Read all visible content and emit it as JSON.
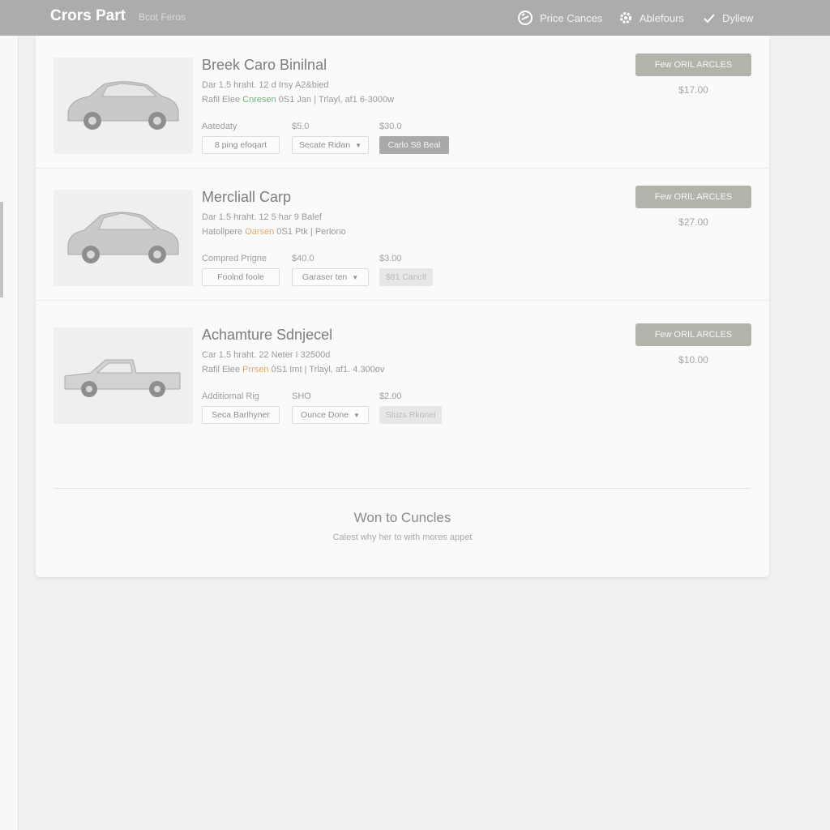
{
  "header": {
    "brand": "Crors Part",
    "brand_sub": "Bcot Feros",
    "nav": [
      {
        "label": "Price Cances",
        "icon": "refresh-icon"
      },
      {
        "label": "Ablefours",
        "icon": "gear-icon"
      },
      {
        "label": "Dyllew",
        "icon": "check-icon"
      }
    ]
  },
  "listings": [
    {
      "title": "Breek Caro Binilnal",
      "spec_line1": "Dar 1.5 hraht. 12 d Irsy A2&bied",
      "spec_line2_pre": "Rafil Elee",
      "spec_highlight": "Cnresen",
      "spec_line2_post": "0S1 Jan  | Trlayl, af1 6-3000w",
      "highlight_color": "#74b27e",
      "options": [
        {
          "label": "Aatedaty",
          "control": "8 ping efoqart"
        },
        {
          "label": "$5.0",
          "control": "Secate Ridan"
        },
        {
          "label": "$30.0",
          "control": "Carlo S8 Beal"
        }
      ],
      "button": "Few ORIL ARCLES",
      "price": "$17.00",
      "car_icon": "sedan-car-icon"
    },
    {
      "title": "Mercliall Carp",
      "spec_line1": "Dar 1.5 hraht. 12 5  har 9 Balef",
      "spec_line2_pre": "Hatollpere",
      "spec_highlight": "Oarsen",
      "spec_line2_post": "0S1 Ptk  | Perlono",
      "highlight_color": "#e3a96a",
      "options": [
        {
          "label": "Compred Prigne",
          "control": "Foolnd foole"
        },
        {
          "label": "$40.0",
          "control": "Garaser ten"
        },
        {
          "label": "$3.00",
          "control": "$81 Canclt"
        }
      ],
      "button": "Few ORIL ARCLES",
      "price": "$27.00",
      "car_icon": "hatchback-car-icon"
    },
    {
      "title": "Achamture Sdnjecel",
      "spec_line1": "Car 1.5 hraht. 22 Neter I 32500d",
      "spec_line2_pre": "Rafil Elee",
      "spec_highlight": "Prrsen",
      "spec_line2_post": "0S1 Imt  | Trlayl, af1. 4.300ov",
      "highlight_color": "#e3a96a",
      "options": [
        {
          "label": "Additiomal Rig",
          "control": "Seca Barlhyner"
        },
        {
          "label": "SHO",
          "control": "Ounce Done"
        },
        {
          "label": "$2.00",
          "control": "Stuzs Rkonel"
        }
      ],
      "button": "Few ORIL ARCLES",
      "price": "$10.00",
      "car_icon": "pickup-truck-icon"
    }
  ],
  "footer": {
    "title": "Won to Cuncles",
    "subtitle": "Calest why her to with mores appet"
  }
}
